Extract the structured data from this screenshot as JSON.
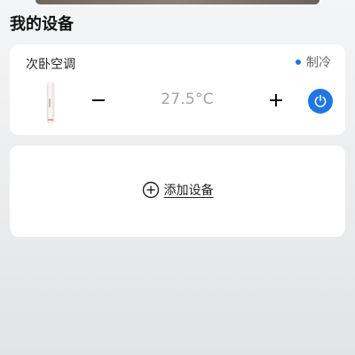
{
  "section": {
    "title": "我的设备"
  },
  "device": {
    "name": "次卧空调",
    "mode": "制冷",
    "mode_color": "#1f78d8",
    "temperature": "27.5°C",
    "icons": {
      "minus": "minus-icon",
      "plus": "plus-icon",
      "power": "power-icon"
    },
    "power_color": "#1f78e0"
  },
  "add_device": {
    "label": "添加设备",
    "icon": "plus-circle-icon"
  }
}
